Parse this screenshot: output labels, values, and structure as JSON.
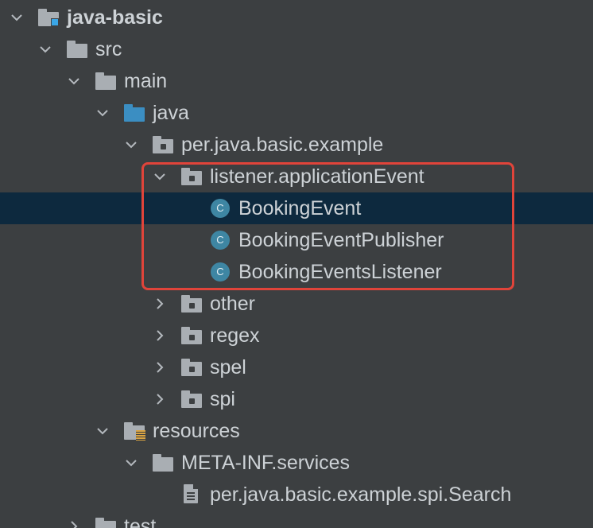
{
  "project_tree": {
    "rows": [
      {
        "label": "java-basic",
        "depth": 0,
        "expanded": true,
        "icon": "module-folder",
        "bold": true
      },
      {
        "label": "src",
        "depth": 1,
        "expanded": true,
        "icon": "folder"
      },
      {
        "label": "main",
        "depth": 2,
        "expanded": true,
        "icon": "folder"
      },
      {
        "label": "java",
        "depth": 3,
        "expanded": true,
        "icon": "source-folder"
      },
      {
        "label": "per.java.basic.example",
        "depth": 4,
        "expanded": true,
        "icon": "package"
      },
      {
        "label": "listener.applicationEvent",
        "depth": 5,
        "expanded": true,
        "icon": "package"
      },
      {
        "label": "BookingEvent",
        "depth": 6,
        "icon": "class",
        "selected": true
      },
      {
        "label": "BookingEventPublisher",
        "depth": 6,
        "icon": "class"
      },
      {
        "label": "BookingEventsListener",
        "depth": 6,
        "icon": "class"
      },
      {
        "label": "other",
        "depth": 5,
        "expanded": false,
        "icon": "package"
      },
      {
        "label": "regex",
        "depth": 5,
        "expanded": false,
        "icon": "package"
      },
      {
        "label": "spel",
        "depth": 5,
        "expanded": false,
        "icon": "package"
      },
      {
        "label": "spi",
        "depth": 5,
        "expanded": false,
        "icon": "package"
      },
      {
        "label": "resources",
        "depth": 3,
        "expanded": true,
        "icon": "resources-folder"
      },
      {
        "label": "META-INF.services",
        "depth": 4,
        "expanded": true,
        "icon": "folder"
      },
      {
        "label": "per.java.basic.example.spi.Search",
        "depth": 5,
        "icon": "file"
      },
      {
        "label": "test",
        "depth": 2,
        "expanded": false,
        "icon": "folder"
      }
    ],
    "class_icon_letter": "C",
    "colors": {
      "background": "#3c3f41",
      "selection": "#0d293e",
      "text": "#cdd2d6",
      "highlight_border": "#e0443a",
      "source_folder": "#3b8ec2",
      "class_icon": "#3e86a3"
    }
  }
}
